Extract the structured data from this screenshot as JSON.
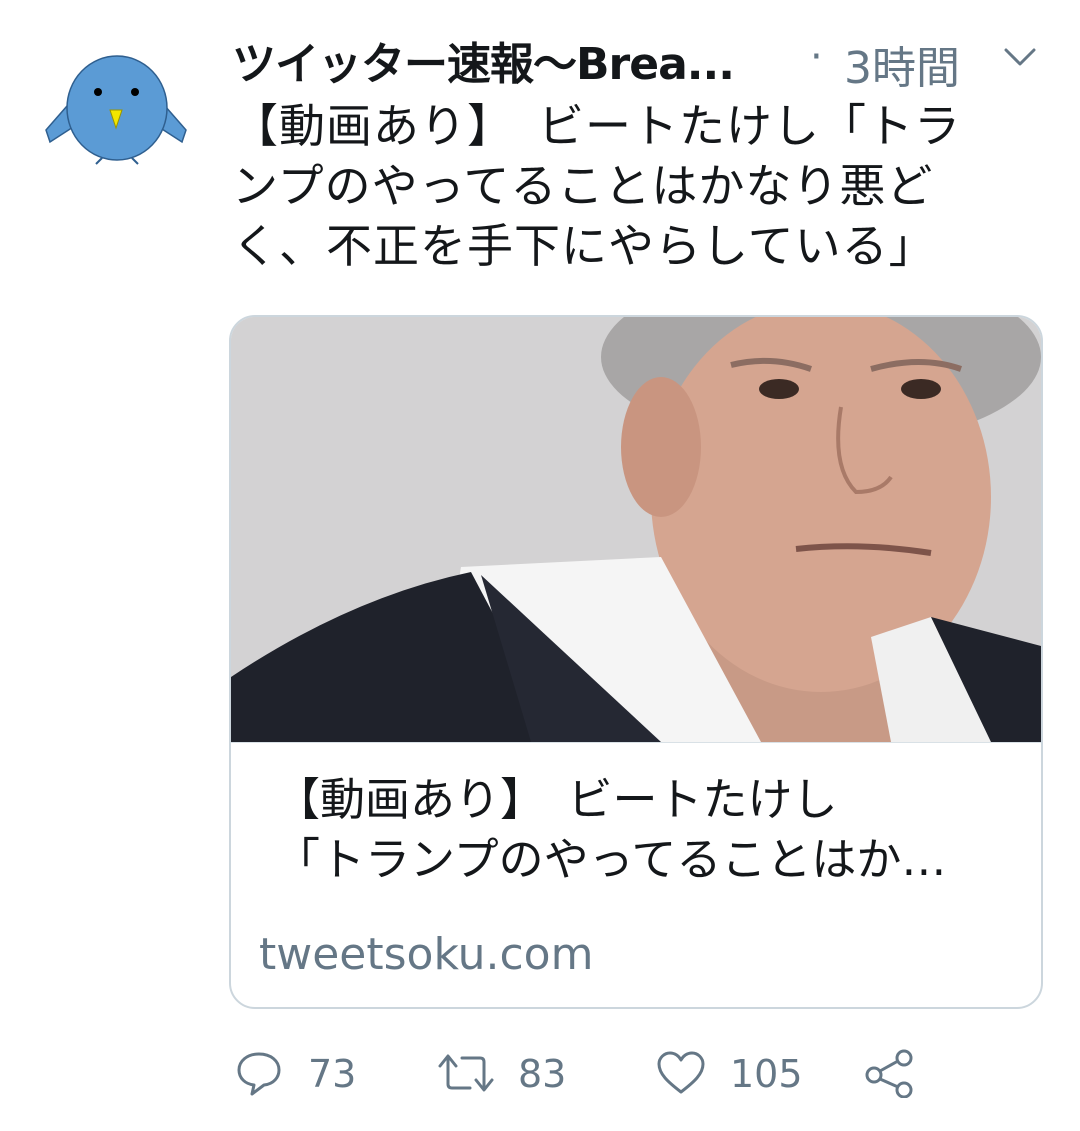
{
  "tweet": {
    "author_name": "ツイッター速報〜Brea...",
    "dot": "·",
    "time": "3時間",
    "text_line1": "【動画あり】　ビートたけし「トラ",
    "text_line2": "ンプのやってることはかなり悪ど",
    "text_line3": "く、不正を手下にやらしている」"
  },
  "card": {
    "title_line1": "【動画あり】　ビートたけし",
    "title_line2": "「トランプのやってることはか…",
    "url": "tweetsoku.com"
  },
  "actions": {
    "reply_count": "73",
    "retweet_count": "83",
    "like_count": "105"
  },
  "colors": {
    "avatar_bird": "#5b9bd5",
    "beak": "#f2e600",
    "secondary_text": "#657786",
    "card_border": "#ccd6dd"
  },
  "icons": {
    "avatar": "bird-avatar-icon",
    "caret": "chevron-down-icon",
    "reply": "speech-bubble-icon",
    "retweet": "retweet-icon",
    "like": "heart-icon",
    "share": "share-icon"
  }
}
